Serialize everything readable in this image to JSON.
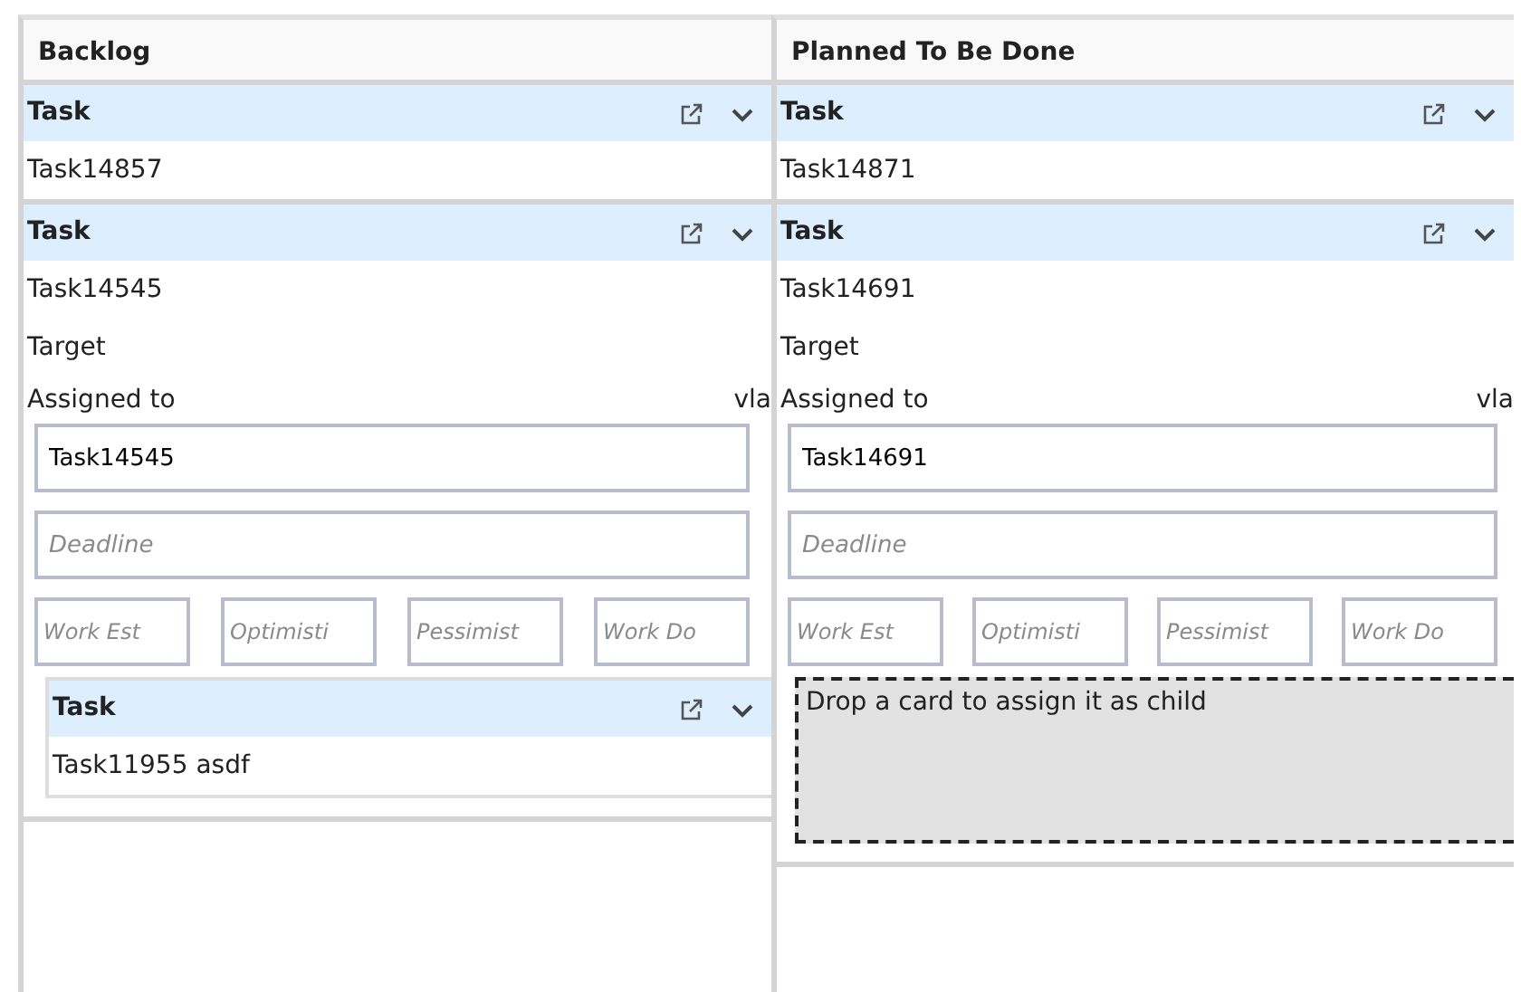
{
  "columns": [
    {
      "title": "Backlog",
      "cards": [
        {
          "type": "Task",
          "title": "Task14857"
        },
        {
          "type": "Task",
          "title": "Task14545",
          "details": {
            "target_label": "Target",
            "assigned_label": "Assigned to",
            "assigned_value": "vla",
            "name_value": "Task14545",
            "deadline_placeholder": "Deadline",
            "estimate_placeholders": [
              "Work Est",
              "Optimisti",
              "Pessimist",
              "Work Do"
            ]
          },
          "children": [
            {
              "type": "Task",
              "title": "Task11955 asdf"
            }
          ]
        }
      ]
    },
    {
      "title": "Planned To Be Done",
      "cards": [
        {
          "type": "Task",
          "title": "Task14871"
        },
        {
          "type": "Task",
          "title": "Task14691",
          "details": {
            "target_label": "Target",
            "assigned_label": "Assigned to",
            "assigned_value": "vla",
            "name_value": "Task14691",
            "deadline_placeholder": "Deadline",
            "estimate_placeholders": [
              "Work Est",
              "Optimisti",
              "Pessimist",
              "Work Do"
            ]
          },
          "drop_zone": "Drop a card to assign it as child"
        }
      ]
    }
  ]
}
